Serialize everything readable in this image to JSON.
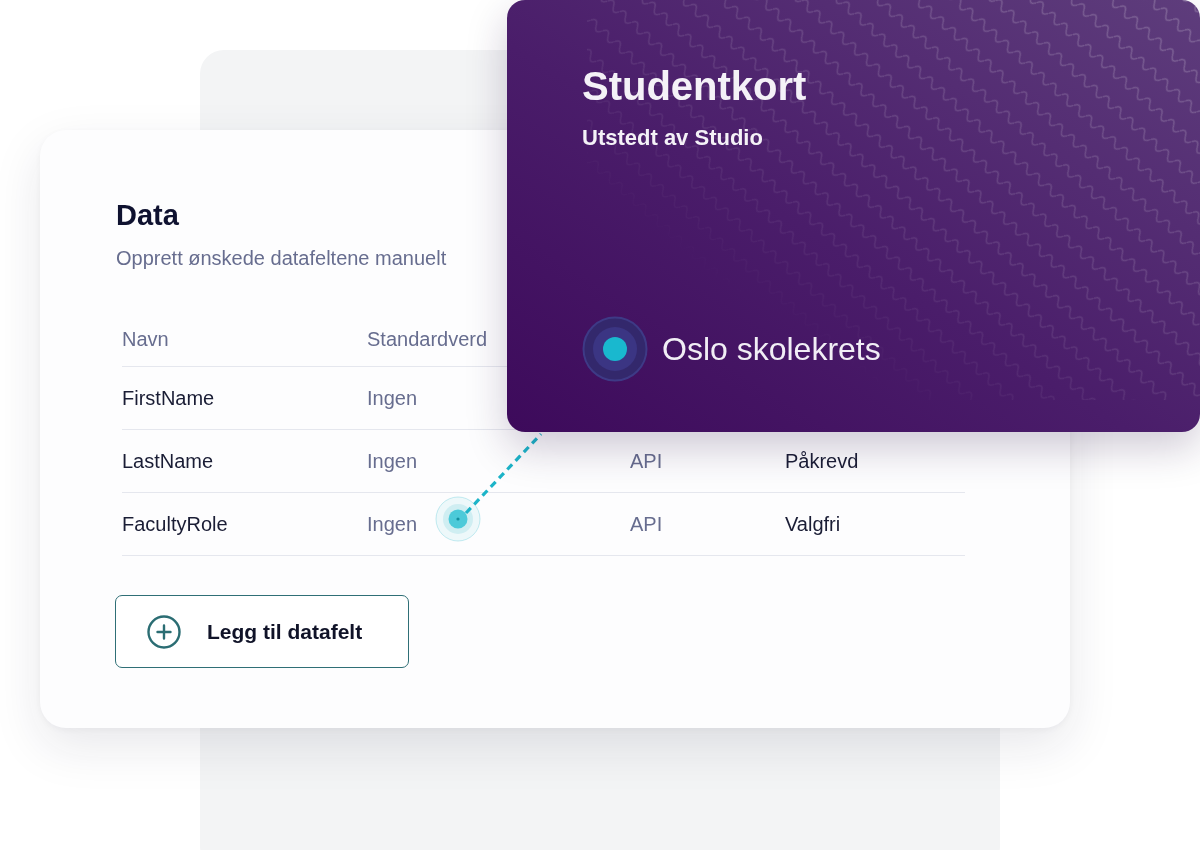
{
  "data_card": {
    "title": "Data",
    "description": "Opprett ønskede datafeltene manuelt",
    "table": {
      "columns": [
        "Navn",
        "Standardverd"
      ],
      "rows": [
        {
          "cells": [
            "FirstName",
            "Ingen"
          ]
        },
        {
          "cells": [
            "LastName",
            "Ingen",
            "API",
            "Påkrevd"
          ]
        },
        {
          "cells": [
            "FacultyRole",
            "Ingen",
            "API",
            "Valgfri"
          ]
        }
      ]
    },
    "add_button": {
      "label": "Legg til datafelt"
    }
  },
  "student_card": {
    "title": "Studentkort",
    "issuer": "Utstedt av Studio",
    "organization": "Oslo skolekrets"
  }
}
